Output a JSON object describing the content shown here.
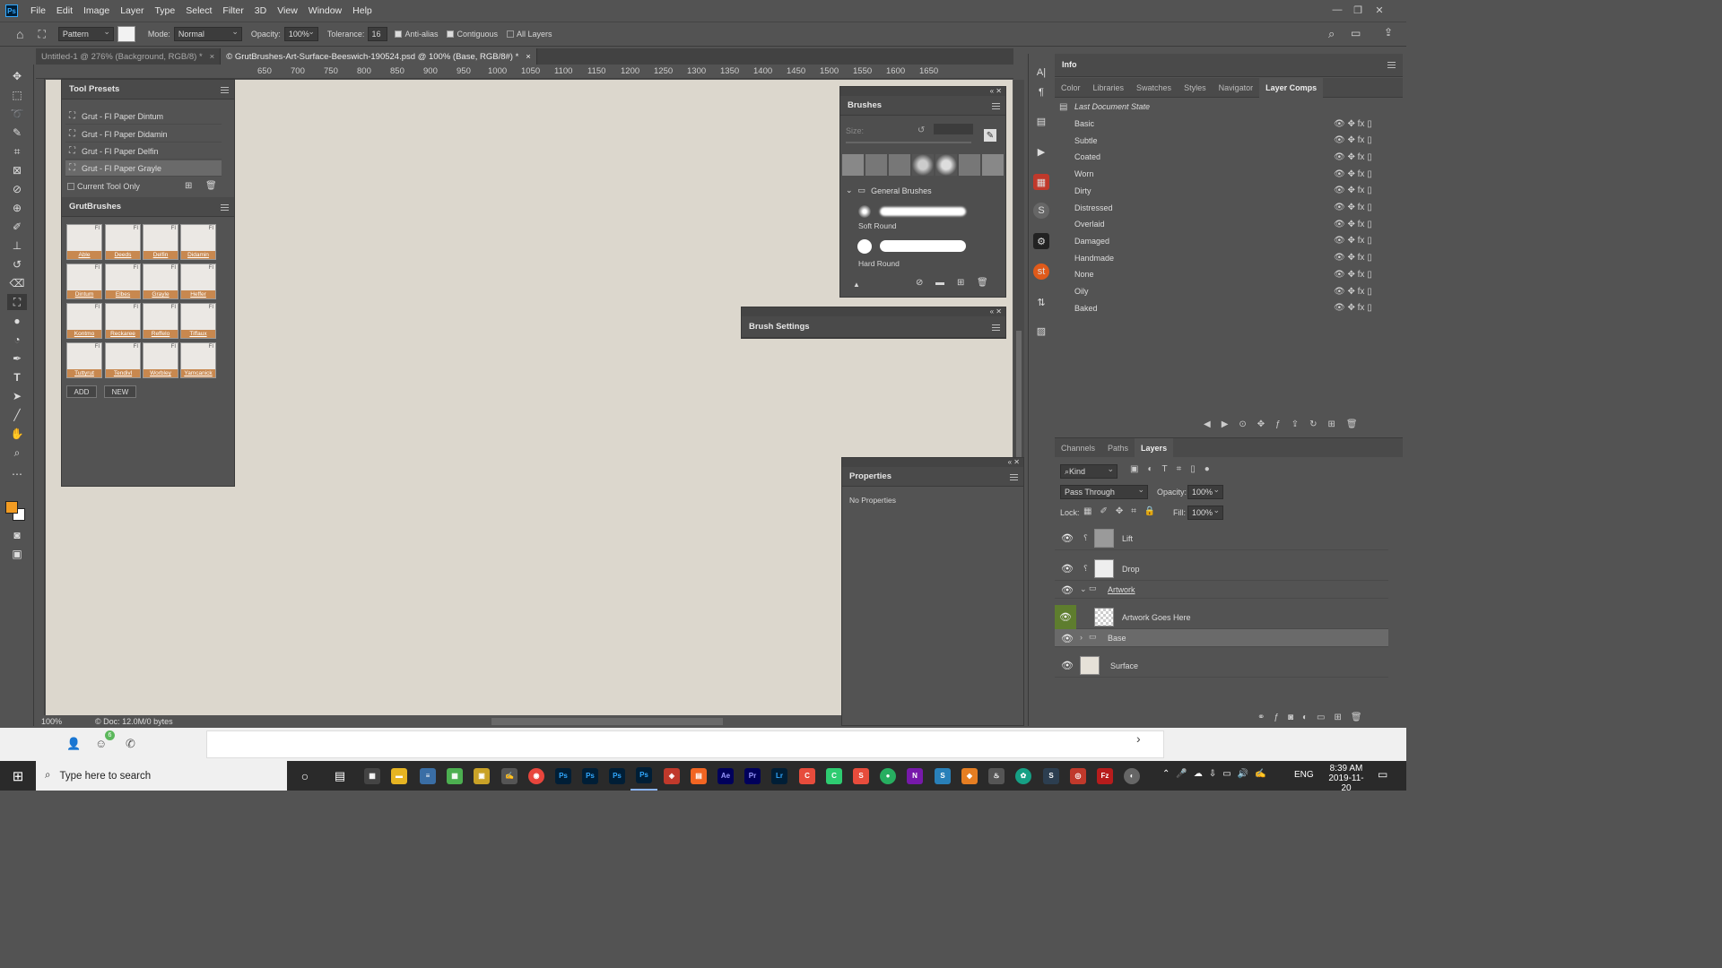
{
  "menubar": {
    "logo": "Ps",
    "items": [
      "File",
      "Edit",
      "Image",
      "Layer",
      "Type",
      "Select",
      "Filter",
      "3D",
      "View",
      "Window",
      "Help"
    ]
  },
  "options": {
    "fill_source": "Pattern",
    "mode_label": "Mode:",
    "mode_value": "Normal",
    "opacity_label": "Opacity:",
    "opacity_value": "100%",
    "tolerance_label": "Tolerance:",
    "tolerance_value": "16",
    "antialias_label": "Anti-alias",
    "contiguous_label": "Contiguous",
    "all_layers_label": "All Layers"
  },
  "tabs": [
    {
      "label": "Untitled-1 @ 276% (Background, RGB/8) *",
      "active": false
    },
    {
      "label": "© GrutBrushes-Art-Surface-Beeswich-190524.psd @ 100% (Base, RGB/8#) *",
      "active": true
    }
  ],
  "ruler_top": [
    "650",
    "700",
    "750",
    "800",
    "850",
    "900",
    "950",
    "1000",
    "1050",
    "1100",
    "1150",
    "1200",
    "1250",
    "1300",
    "1350",
    "1400",
    "1450",
    "1500",
    "1550",
    "1600",
    "1650"
  ],
  "status": {
    "zoom": "100%",
    "doc": "© Doc: 12.0M/0 bytes"
  },
  "tool_presets": {
    "title": "Tool Presets",
    "items": [
      "Grut - FI Paper Dintum",
      "Grut - FI Paper Didamin",
      "Grut - FI Paper Delfin",
      "Grut - FI Paper Grayle"
    ],
    "current_only": "Current Tool Only"
  },
  "grutbrushes": {
    "title": "GrutBrushes",
    "thumbs": [
      "Able",
      "Deeds",
      "Delfin",
      "Didamin",
      "Dintum",
      "Elbes",
      "Grayle",
      "Heffer",
      "Kontmo",
      "Reckaree",
      "Reffelo",
      "Tiffaux",
      "Tuttyrut",
      "Tendivl",
      "Worbley",
      "Yamcanick"
    ],
    "thumb_tag": "FI",
    "add_label": "ADD",
    "new_label": "NEW"
  },
  "brushes": {
    "title": "Brushes",
    "size_label": "Size:",
    "group": "General Brushes",
    "items": [
      "Soft Round",
      "Hard Round"
    ]
  },
  "brush_settings": {
    "title": "Brush Settings"
  },
  "properties": {
    "title": "Properties",
    "empty": "No Properties"
  },
  "info_panel": {
    "title": "Info"
  },
  "right_tabs": [
    "Color",
    "Libraries",
    "Swatches",
    "Styles",
    "Navigator",
    "Layer Comps"
  ],
  "layer_comps": {
    "last_state": "Last Document State",
    "items": [
      "Basic",
      "Subtle",
      "Coated",
      "Worn",
      "Dirty",
      "Distressed",
      "Overlaid",
      "Damaged",
      "Handmade",
      "None",
      "Oily",
      "Baked"
    ]
  },
  "layers_tabs": [
    "Channels",
    "Paths",
    "Layers"
  ],
  "layers_panel": {
    "kind_label": "Kind",
    "blend": "Pass Through",
    "opacity_label": "Opacity:",
    "opacity": "100%",
    "lock_label": "Lock:",
    "fill_label": "Fill:",
    "fill": "100%",
    "layers": [
      {
        "name": "Lift",
        "kind": "smart"
      },
      {
        "name": "Drop",
        "kind": "smart"
      },
      {
        "name": "Artwork",
        "kind": "group-open"
      },
      {
        "name": "Artwork Goes Here",
        "kind": "transparent"
      },
      {
        "name": "Base",
        "kind": "group",
        "selected": true
      },
      {
        "name": "Surface",
        "kind": "paper"
      }
    ]
  },
  "taskbar": {
    "search_placeholder": "Type here to search",
    "lang": "ENG",
    "time": "8:39 AM",
    "date": "2019-11-20",
    "badge": "6"
  },
  "colors": {
    "fg": "#f19b22",
    "bg": "#ffffff",
    "canvas": "#dcd7cd"
  }
}
